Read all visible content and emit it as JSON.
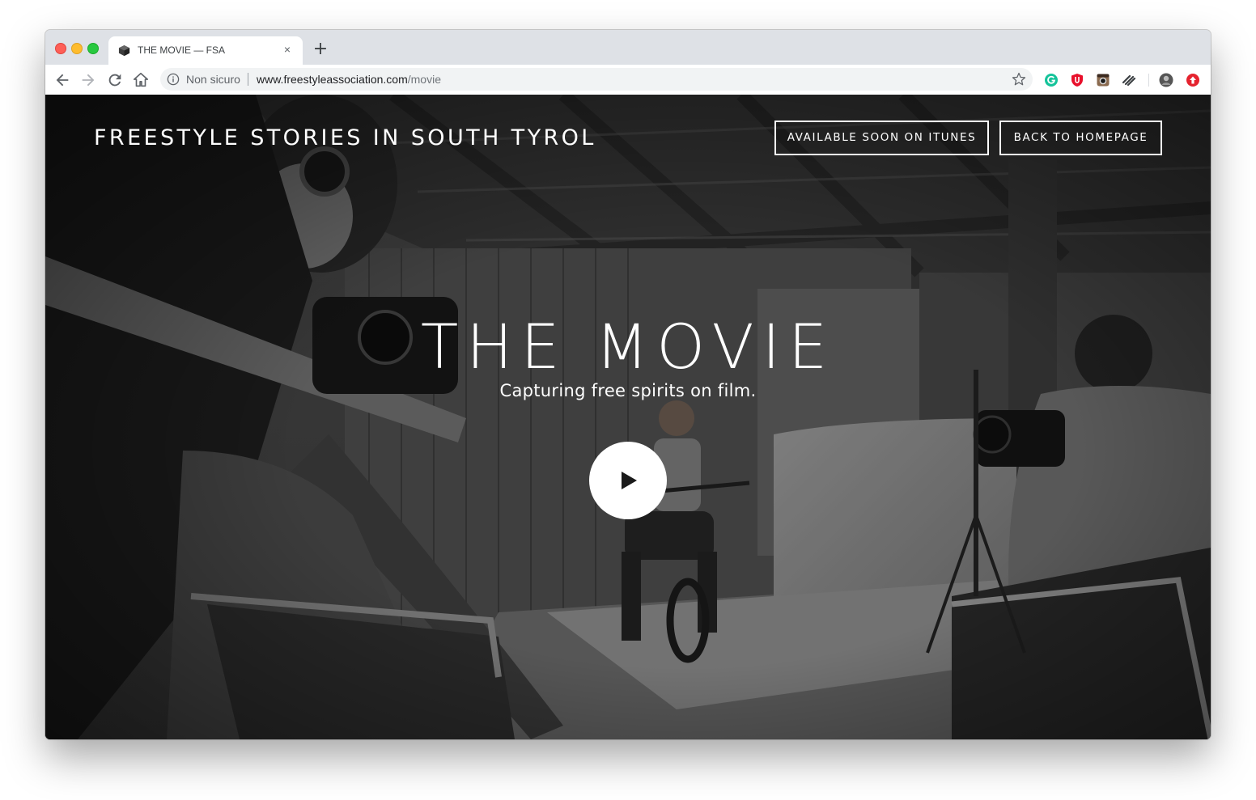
{
  "browser": {
    "tab": {
      "title": "THE MOVIE — FSA",
      "close_glyph": "×",
      "favicon": "cube-icon"
    },
    "new_tab_glyph": "+",
    "toolbar": {
      "back_icon": "arrow-left-icon",
      "forward_icon": "arrow-right-icon",
      "reload_icon": "reload-icon",
      "home_icon": "home-icon"
    },
    "omnibox": {
      "security_label": "Non sicuro",
      "url_host": "www.freestyleassociation.com",
      "url_path": "/movie"
    },
    "extensions": [
      "grammarly-icon",
      "ublock-icon",
      "instagram-icon",
      "stripes-icon",
      "profile-avatar-icon",
      "update-icon"
    ]
  },
  "page": {
    "site_title": "FREESTYLE STORIES IN SOUTH TYROL",
    "buttons": {
      "itunes": "AVAILABLE SOON ON ITUNES",
      "homepage": "BACK TO HOMEPAGE"
    },
    "hero": {
      "heading": "THE MOVIE",
      "subtitle": "Capturing free spirits on film.",
      "play_icon": "play-icon"
    }
  },
  "colors": {
    "chrome_bg": "#dee1e6",
    "omnibox_bg": "#f1f3f4",
    "text_on_photo": "#ffffff",
    "ext_grammarly": "#15c39a",
    "ext_ublock": "#e8102b",
    "ext_update": "#e5232f"
  }
}
